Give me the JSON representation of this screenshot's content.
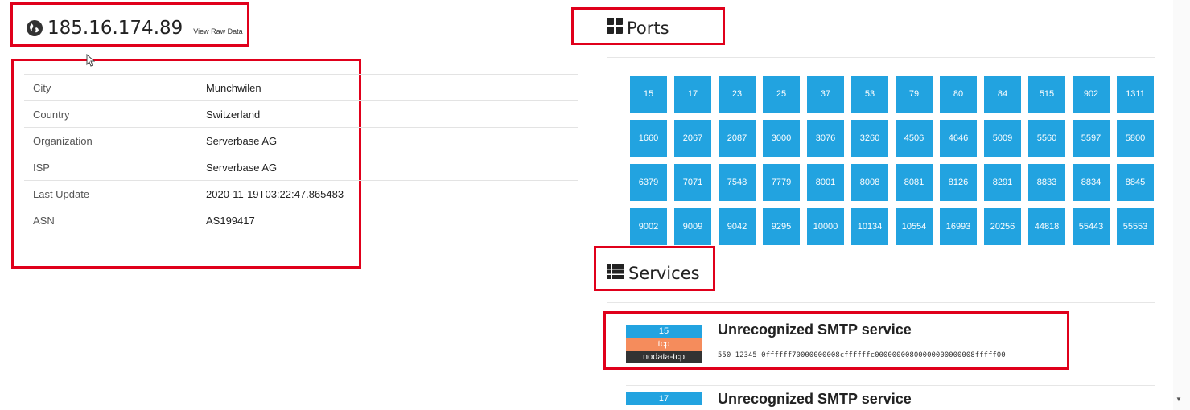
{
  "host": {
    "ip": "185.16.174.89",
    "raw_link": "View Raw Data"
  },
  "info": [
    {
      "key": "City",
      "value": "Munchwilen"
    },
    {
      "key": "Country",
      "value": "Switzerland"
    },
    {
      "key": "Organization",
      "value": "Serverbase AG"
    },
    {
      "key": "ISP",
      "value": "Serverbase AG"
    },
    {
      "key": "Last Update",
      "value": "2020-11-19T03:22:47.865483"
    },
    {
      "key": "ASN",
      "value": "AS199417"
    }
  ],
  "ports": {
    "title": "Ports",
    "list": [
      "15",
      "17",
      "23",
      "25",
      "37",
      "53",
      "79",
      "80",
      "84",
      "515",
      "902",
      "1311",
      "1660",
      "2067",
      "2087",
      "3000",
      "3076",
      "3260",
      "4506",
      "4646",
      "5009",
      "5560",
      "5597",
      "5800",
      "6379",
      "7071",
      "7548",
      "7779",
      "8001",
      "8008",
      "8081",
      "8126",
      "8291",
      "8833",
      "8834",
      "8845",
      "9002",
      "9009",
      "9042",
      "9295",
      "10000",
      "10134",
      "10554",
      "16993",
      "20256",
      "44818",
      "55443",
      "55553"
    ]
  },
  "services": {
    "title": "Services",
    "items": [
      {
        "port": "15",
        "proto": "tcp",
        "tag": "nodata-tcp",
        "name": "Unrecognized SMTP service",
        "banner": "550 12345 0ffffff70000000008cffffffc00000000800000000000008fffff00"
      },
      {
        "port": "17",
        "name": "Unrecognized SMTP service"
      }
    ]
  },
  "colors": {
    "accent": "#22a3e0",
    "proto": "#f58c5c",
    "highlight": "#e0001b"
  }
}
